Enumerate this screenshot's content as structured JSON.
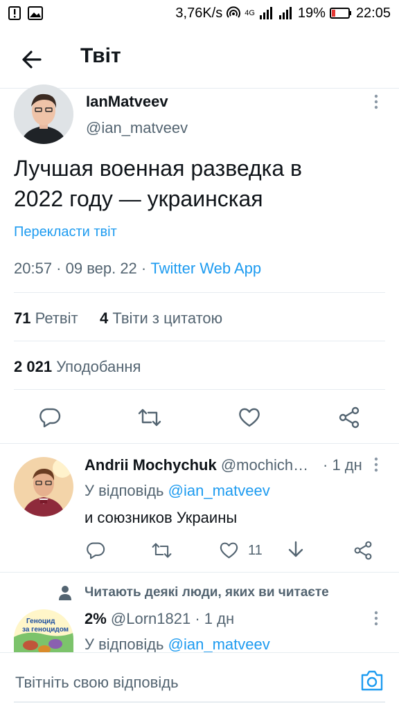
{
  "status_bar": {
    "network_speed": "3,76K/s",
    "network_type": "4G",
    "battery": "19%",
    "time": "22:05"
  },
  "header": {
    "title": "Твіт"
  },
  "tweet": {
    "display_name": "IanMatveev",
    "handle": "@ian_matveev",
    "text_line1": "Лучшая военная разведка в",
    "text_line2": "2022 году — украинская",
    "translate_label": "Перекласти твіт",
    "timestamp": "20:57 · 09 вер. 22 · ",
    "source": "Twitter Web App",
    "retweets_count": "71",
    "retweets_label": "Ретвіт",
    "quotes_count": "4",
    "quotes_label": "Твіти з цитатою",
    "likes_count": "2 021",
    "likes_label": "Уподобання"
  },
  "reply1": {
    "display_name": "Andrii Mochychuk",
    "handle": "@mochich…",
    "time": "· 1 дн",
    "reply_prefix": "У відповідь",
    "reply_to": "@ian_matveev",
    "text": "и союзников Украины",
    "likes": "11"
  },
  "social_context": {
    "text": "Читають деякі люди, яких ви читаєте"
  },
  "reply2": {
    "display_name": "2%",
    "handle": "@Lorn1821",
    "time": "· 1 дн",
    "reply_prefix": "У відповідь",
    "reply_to": "@ian_matveev",
    "avatar_text_line1": "Геноцид",
    "avatar_text_line2": "за геноцидом"
  },
  "composer": {
    "placeholder": "Твітніть свою відповідь"
  },
  "colors": {
    "accent": "#1d9bf0",
    "muted": "#536471",
    "divider": "#e6ecf0"
  }
}
